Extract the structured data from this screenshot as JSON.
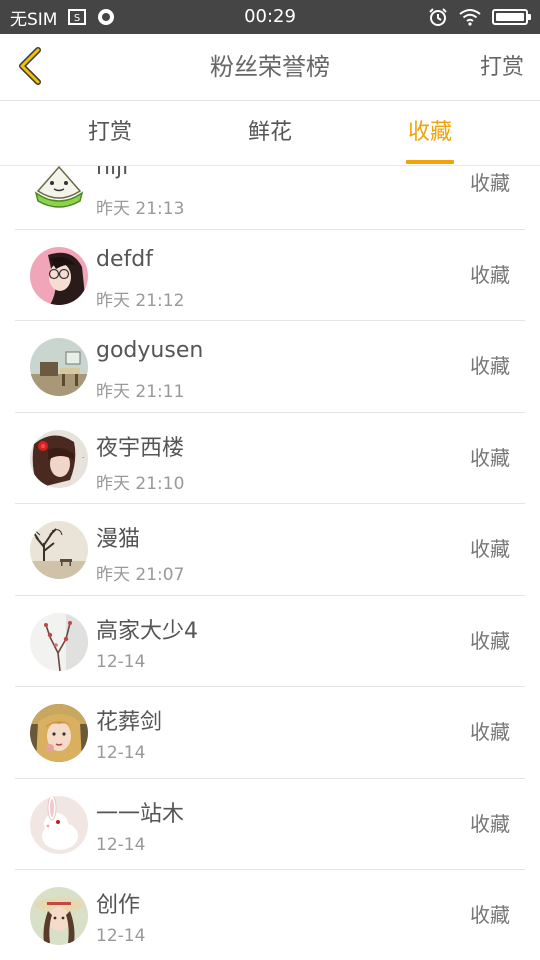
{
  "status_bar": {
    "carrier": "无SIM",
    "time": "00:29",
    "icons": [
      "screenshot-icon",
      "app-notification-icon",
      "alarm-icon",
      "wifi-icon",
      "battery-icon"
    ],
    "battery_level": 1.0
  },
  "header": {
    "back_icon": "chevron-left-icon",
    "title": "粉丝荣誉榜",
    "action_label": "打赏"
  },
  "tabs": [
    {
      "label": "打赏",
      "active": false
    },
    {
      "label": "鲜花",
      "active": false
    },
    {
      "label": "收藏",
      "active": true
    }
  ],
  "accent_color": "#f0a30a",
  "list": [
    {
      "name": "niji",
      "time": "昨天 21:13",
      "action": "收藏",
      "avatar": "cartoon-rice-dumpling-avatar"
    },
    {
      "name": "defdf",
      "time": "昨天 21:12",
      "action": "收藏",
      "avatar": "girl-portrait-avatar"
    },
    {
      "name": "godyusen",
      "time": "昨天 21:11",
      "action": "收藏",
      "avatar": "room-scene-avatar"
    },
    {
      "name": "夜宇西楼",
      "time": "昨天 21:10",
      "action": "收藏",
      "avatar": "girl-red-flower-avatar"
    },
    {
      "name": "漫猫",
      "time": "昨天 21:07",
      "action": "收藏",
      "avatar": "tree-landscape-avatar"
    },
    {
      "name": "高家大少4",
      "time": "12-14",
      "action": "收藏",
      "avatar": "plum-blossom-avatar"
    },
    {
      "name": "花葬剑",
      "time": "12-14",
      "action": "收藏",
      "avatar": "woman-portrait-avatar"
    },
    {
      "name": "一一站木",
      "time": "12-14",
      "action": "收藏",
      "avatar": "white-rabbit-avatar"
    },
    {
      "name": "创作",
      "time": "12-14",
      "action": "收藏",
      "avatar": "girl-hat-avatar"
    }
  ]
}
